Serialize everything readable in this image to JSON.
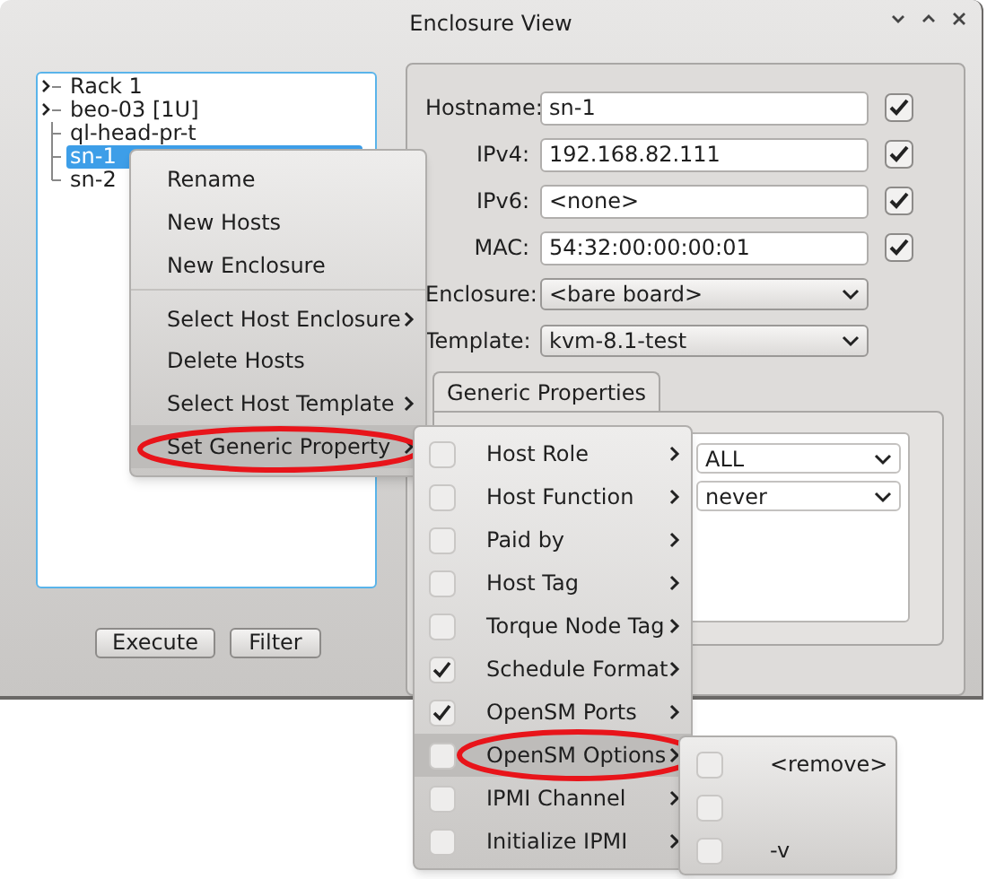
{
  "window": {
    "title": "Enclosure View"
  },
  "tree": {
    "items": [
      {
        "label": "Rack 1",
        "expandable": true,
        "selected": false
      },
      {
        "label": "beo-03 [1U]",
        "expandable": true,
        "selected": false
      },
      {
        "label": "ql-head-pr-t",
        "expandable": false,
        "selected": false
      },
      {
        "label": "sn-1",
        "expandable": false,
        "selected": true
      },
      {
        "label": "sn-2",
        "expandable": false,
        "selected": false
      }
    ]
  },
  "buttons": [
    "Execute",
    "Filter"
  ],
  "form": [
    {
      "kind": "text",
      "label": "Hostname:",
      "value": "sn-1",
      "checked": true
    },
    {
      "kind": "text",
      "label": "IPv4:",
      "value": "192.168.82.111",
      "checked": true
    },
    {
      "kind": "text",
      "label": "IPv6:",
      "value": "<none>",
      "checked": true
    },
    {
      "kind": "text",
      "label": "MAC:",
      "value": "54:32:00:00:00:01",
      "checked": true
    },
    {
      "kind": "select",
      "label": "Enclosure:",
      "value": "<bare board>"
    },
    {
      "kind": "select",
      "label": "Template:",
      "value": "kvm-8.1-test"
    }
  ],
  "tabs": [
    {
      "label": "Generic Properties",
      "selected": true
    }
  ],
  "property_values": [
    "ALL",
    "never"
  ],
  "context_menu": [
    {
      "label": "Rename",
      "submenu": false,
      "selected": false,
      "circled": false,
      "separator_before": false
    },
    {
      "label": "New Hosts",
      "submenu": false,
      "selected": false,
      "circled": false,
      "separator_before": false
    },
    {
      "label": "New Enclosure",
      "submenu": false,
      "selected": false,
      "circled": false,
      "separator_before": false
    },
    {
      "label": "Select Host Enclosure",
      "submenu": true,
      "selected": false,
      "circled": false,
      "separator_before": true
    },
    {
      "label": "Delete Hosts",
      "submenu": false,
      "selected": false,
      "circled": false,
      "separator_before": false
    },
    {
      "label": "Select Host Template",
      "submenu": true,
      "selected": false,
      "circled": false,
      "separator_before": false
    },
    {
      "label": "Set Generic Property",
      "submenu": true,
      "selected": true,
      "circled": true,
      "separator_before": false
    }
  ],
  "property_menu": [
    {
      "label": "Host Role",
      "checked": false,
      "selected": false,
      "circled": false
    },
    {
      "label": "Host Function",
      "checked": false,
      "selected": false,
      "circled": false
    },
    {
      "label": "Paid by",
      "checked": false,
      "selected": false,
      "circled": false
    },
    {
      "label": "Host Tag",
      "checked": false,
      "selected": false,
      "circled": false
    },
    {
      "label": "Torque Node Tag",
      "checked": false,
      "selected": false,
      "circled": false
    },
    {
      "label": "Schedule Format",
      "checked": true,
      "selected": false,
      "circled": false
    },
    {
      "label": "OpenSM Ports",
      "checked": true,
      "selected": false,
      "circled": false
    },
    {
      "label": "OpenSM Options",
      "checked": false,
      "selected": true,
      "circled": true
    },
    {
      "label": "IPMI Channel",
      "checked": false,
      "selected": false,
      "circled": false
    },
    {
      "label": "Initialize IPMI",
      "checked": false,
      "selected": false,
      "circled": false
    }
  ],
  "option_menu": [
    {
      "label": "<remove>",
      "checked": false
    },
    {
      "checked": false
    },
    {
      "label": "-v",
      "checked": false
    }
  ]
}
